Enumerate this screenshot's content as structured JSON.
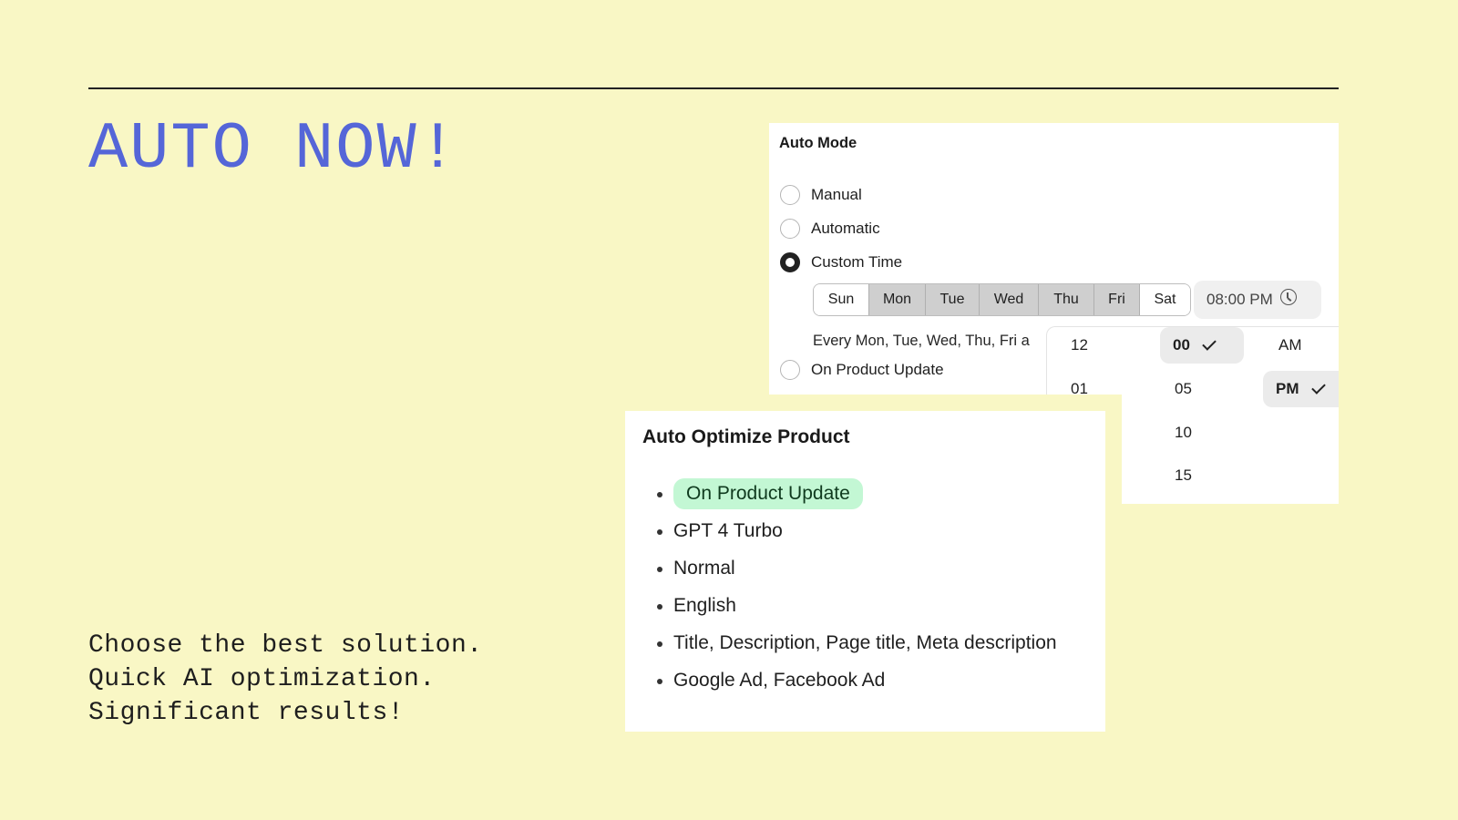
{
  "hero": {
    "headline": "AUTO NOW!",
    "tagline": [
      "Choose the best solution.",
      "Quick AI optimization.",
      "Significant results!"
    ],
    "accent_color": "#5566d8",
    "background_color": "#f9f7c5"
  },
  "auto_mode": {
    "title": "Auto Mode",
    "options": [
      {
        "label": "Manual",
        "checked": false
      },
      {
        "label": "Automatic",
        "checked": false
      },
      {
        "label": "Custom Time",
        "checked": true
      },
      {
        "label": "On Product Update",
        "checked": false
      }
    ],
    "days": [
      {
        "label": "Sun",
        "selected": false
      },
      {
        "label": "Mon",
        "selected": true
      },
      {
        "label": "Tue",
        "selected": true
      },
      {
        "label": "Wed",
        "selected": true
      },
      {
        "label": "Thu",
        "selected": true
      },
      {
        "label": "Fri",
        "selected": true
      },
      {
        "label": "Sat",
        "selected": false
      }
    ],
    "time_value": "08:00 PM",
    "time_icon": "clock-icon",
    "schedule_summary": "Every Mon, Tue, Wed, Thu, Fri a"
  },
  "time_picker": {
    "hours": [
      "12",
      "01"
    ],
    "minutes": [
      {
        "label": "00",
        "selected": true
      },
      {
        "label": "05",
        "selected": false
      },
      {
        "label": "10",
        "selected": false
      },
      {
        "label": "15",
        "selected": false
      }
    ],
    "periods": [
      {
        "label": "AM",
        "selected": false
      },
      {
        "label": "PM",
        "selected": true
      }
    ]
  },
  "auto_optimize": {
    "title": "Auto Optimize Product",
    "trigger_badge": "On Product Update",
    "badge_color": "#c3f7d4",
    "items": [
      "GPT 4 Turbo",
      "Normal",
      "English",
      "Title, Description, Page title, Meta description",
      "Google Ad, Facebook Ad"
    ]
  }
}
